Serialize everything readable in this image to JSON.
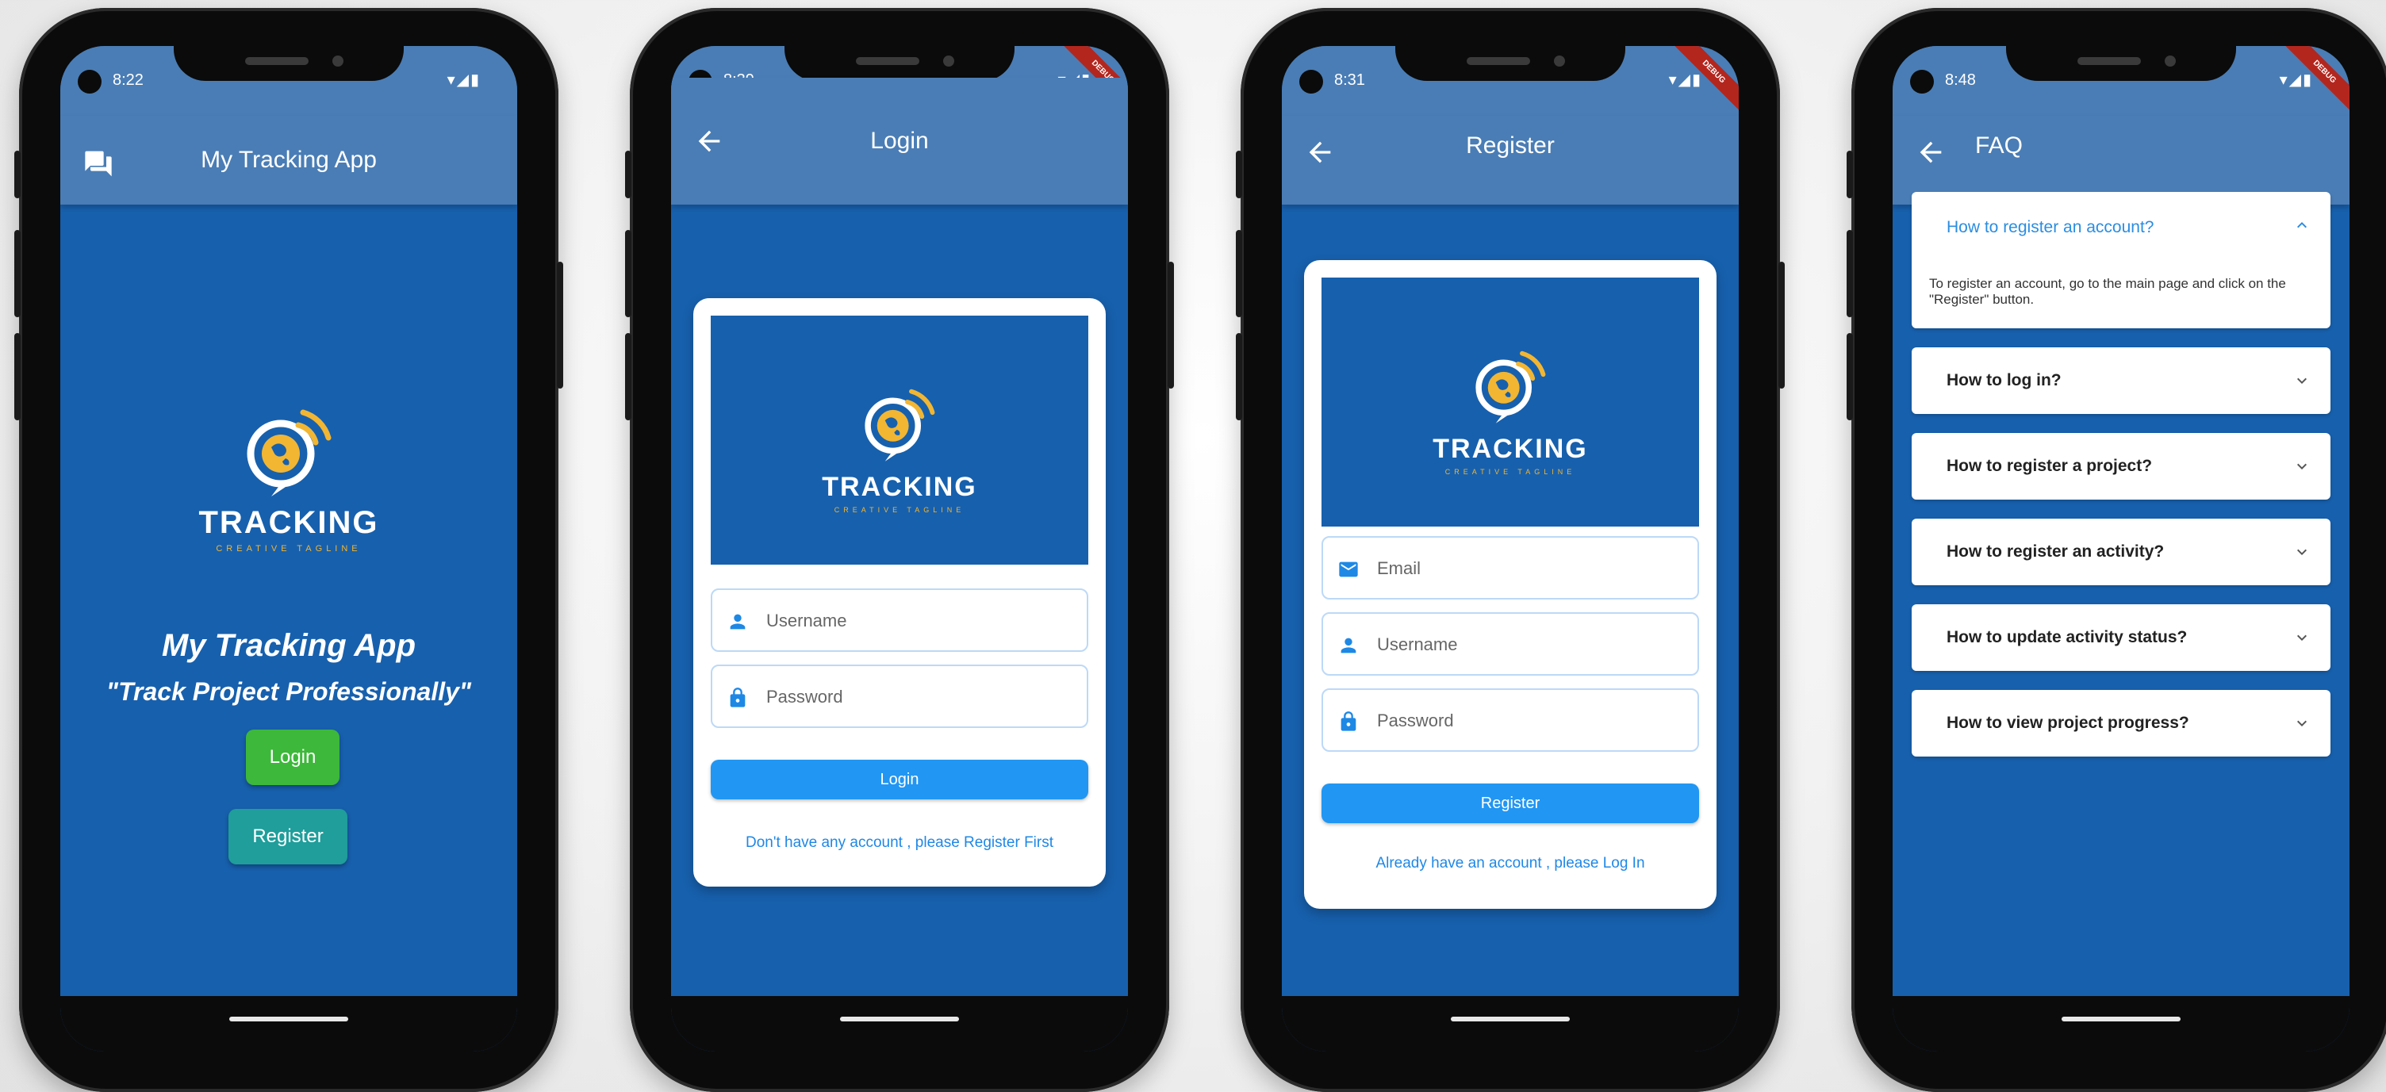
{
  "brand": {
    "logo_word": "TRACKING",
    "logo_tagline": "CREATIVE TAGLINE",
    "color_blue": "#1760ad",
    "color_gold": "#f2b632"
  },
  "screens": {
    "home": {
      "time": "8:22",
      "appbar_title": "My Tracking App",
      "appbar_icon": "chat-icon",
      "app_name": "My Tracking App",
      "slogan": "\"Track Project Professionally\"",
      "login_label": "Login",
      "register_label": "Register",
      "login_color": "#3db83a",
      "register_color": "#1f9e9b"
    },
    "login": {
      "time": "8:39",
      "appbar_title": "Login",
      "username_placeholder": "Username",
      "password_placeholder": "Password",
      "submit_label": "Login",
      "footer_link": "Don't have any account , please Register First"
    },
    "register": {
      "time": "8:31",
      "appbar_title": "Register",
      "email_placeholder": "Email",
      "username_placeholder": "Username",
      "password_placeholder": "Password",
      "submit_label": "Register",
      "footer_link": "Already have an account , please Log In"
    },
    "faq": {
      "time": "8:48",
      "appbar_title": "FAQ",
      "items": [
        {
          "question": "How to register an account?",
          "answer": "To register an account, go to the main page and click on the \"Register\" button.",
          "expanded": true
        },
        {
          "question": "How to log in?",
          "expanded": false
        },
        {
          "question": "How to register a project?",
          "expanded": false
        },
        {
          "question": "How to register an activity?",
          "expanded": false
        },
        {
          "question": "How to update activity status?",
          "expanded": false
        },
        {
          "question": "How to view project progress?",
          "expanded": false
        }
      ]
    }
  },
  "status_icons": "▾◢▮",
  "debug_banner": "DEBUG"
}
